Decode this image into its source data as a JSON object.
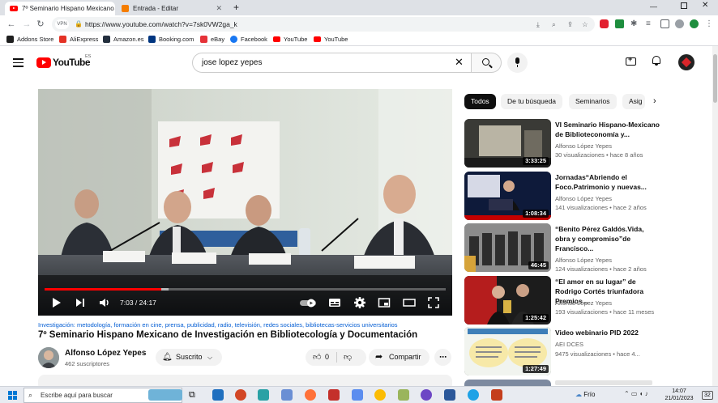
{
  "browser": {
    "tabs": [
      {
        "label": "7º Seminario Hispano Mexicano",
        "favicon": "youtube-icon",
        "active": true
      },
      {
        "label": "Entrada - Editar",
        "favicon": "blogger-icon",
        "active": false
      }
    ],
    "new_tab_label": "+",
    "url": "https://www.youtube.com/watch?v=7sk0VW2ga_k",
    "bookmarks": [
      {
        "label": "Addons Store",
        "color": "#1f1f1f"
      },
      {
        "label": "AliExpress",
        "color": "#e43225"
      },
      {
        "label": "Amazon.es",
        "color": "#232f3e"
      },
      {
        "label": "Booking.com",
        "color": "#003580"
      },
      {
        "label": "eBay",
        "color": "#e53238"
      },
      {
        "label": "Facebook",
        "color": "#1877f2"
      },
      {
        "label": "YouTube",
        "color": "#ff0000"
      },
      {
        "label": "YouTube",
        "color": "#ff0000"
      }
    ]
  },
  "youtube": {
    "logo_text": "YouTube",
    "country_code": "ES",
    "search_query": "jose lopez yepes",
    "video": {
      "current_time": "7:03",
      "duration": "24:17",
      "progress_fraction": 0.29,
      "buffered_fraction": 0.31,
      "tags": "Investigación: metodología, formación en cine, prensa, publicidad, radio, televisión, redes sociales, bibliotecas-servicios universitarios",
      "title": "7º Seminario Hispano Mexicano de Investigación en Bibliotecología y Documentación",
      "channel": "Alfonso López Yepes",
      "subscribers": "462 suscriptores",
      "subscribe_label": "Suscrito",
      "like_count": "0",
      "share_label": "Compartir"
    },
    "chips": [
      "Todos",
      "De tu búsqueda",
      "Seminarios",
      "Asig"
    ],
    "recommendations": [
      {
        "title": "VI Seminario Hispano-Mexicano de Biblioteconomía y...",
        "channel": "Alfonso López Yepes",
        "stats": "30 visualizaciones  • hace 8 años",
        "duration": "3:33:25"
      },
      {
        "title": "Jornadas“Abriendo el Foco.Patrimonio y nuevas...",
        "channel": "Alfonso López Yepes",
        "stats": "141 visualizaciones  • hace 2 años",
        "duration": "1:08:34"
      },
      {
        "title": "“Benito Pérez Galdós.Vida, obra y compromiso”de Francisco...",
        "channel": "Alfonso López Yepes",
        "stats": "124 visualizaciones  • hace 2 años",
        "duration": "46:45"
      },
      {
        "title": "“El amor en su lugar” de Rodrigo Cortés triunfadora Premios...",
        "channel": "Alfonso López Yepes",
        "stats": "193 visualizaciones  • hace 11 meses",
        "duration": "1:25:42"
      },
      {
        "title": "Video webinario PID 2022",
        "channel": "AEI DCES",
        "stats": "9475 visualizaciones  • hace 4...",
        "duration": "1:27:49"
      }
    ]
  },
  "taskbar": {
    "search_placeholder": "Escribe aquí para buscar",
    "weather": "Frío",
    "time": "14:07",
    "date": "21/01/2023",
    "notifications": "32"
  }
}
